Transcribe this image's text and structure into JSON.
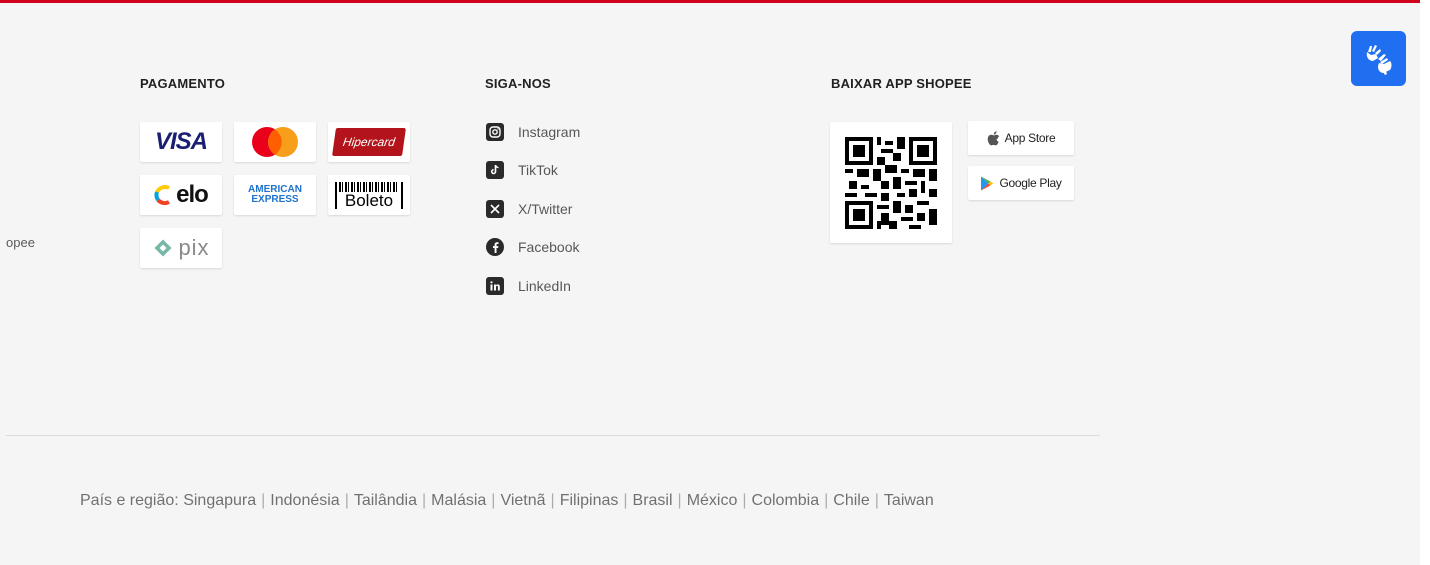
{
  "side_text": "opee",
  "payment": {
    "heading": "PAGAMENTO",
    "methods": [
      {
        "name": "visa",
        "label": "VISA"
      },
      {
        "name": "mastercard",
        "label": ""
      },
      {
        "name": "hipercard",
        "label": "Hipercard"
      },
      {
        "name": "elo",
        "label": "elo"
      },
      {
        "name": "american-express",
        "label_line1": "AMERICAN",
        "label_line2": "EXPRESS"
      },
      {
        "name": "boleto",
        "label": "Boleto"
      },
      {
        "name": "pix",
        "label": "pix"
      }
    ]
  },
  "social": {
    "heading": "SIGA-NOS",
    "items": [
      {
        "label": "Instagram",
        "icon": "instagram-icon"
      },
      {
        "label": "TikTok",
        "icon": "tiktok-icon"
      },
      {
        "label": "X/Twitter",
        "icon": "x-twitter-icon"
      },
      {
        "label": "Facebook",
        "icon": "facebook-icon"
      },
      {
        "label": "LinkedIn",
        "icon": "linkedin-icon"
      }
    ]
  },
  "app": {
    "heading": "BAIXAR APP SHOPEE",
    "app_store_label": "App Store",
    "google_play_label": "Google Play"
  },
  "countries": {
    "prefix": "País e região:",
    "list": [
      "Singapura",
      "Indonésia",
      "Tailândia",
      "Malásia",
      "Vietnã",
      "Filipinas",
      "Brasil",
      "México",
      "Colombia",
      "Chile",
      "Taiwan"
    ]
  },
  "colors": {
    "brand_red": "#d0011b",
    "accessibility_blue": "#1f6ff0",
    "footer_bg": "#f5f5f5"
  }
}
